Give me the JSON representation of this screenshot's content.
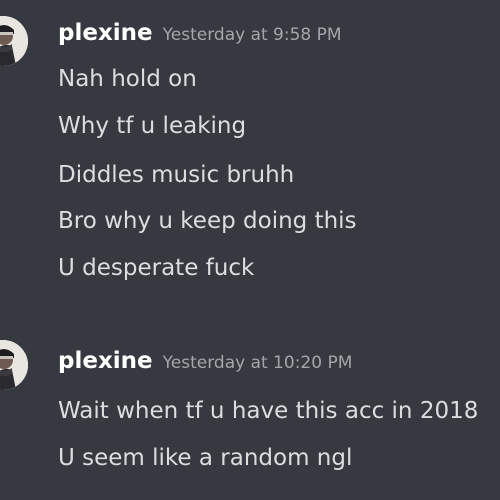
{
  "messages": [
    {
      "username": "plexine",
      "timestamp": "Yesterday at 9:58 PM",
      "lines": [
        "Nah hold on",
        "Why tf u leaking",
        "Diddles music bruhh",
        "Bro why u keep doing this",
        "U desperate fuck"
      ]
    },
    {
      "username": "plexine",
      "timestamp": "Yesterday at 10:20 PM",
      "lines": [
        "Wait when tf u have this acc in 2018",
        "U seem like a random ngl"
      ]
    }
  ],
  "colors": {
    "background": "#36393f",
    "username": "#ffffff",
    "timestamp": "#a3a6aa",
    "text": "#dcddde"
  },
  "icons": {
    "avatar": "user-avatar-icon"
  }
}
